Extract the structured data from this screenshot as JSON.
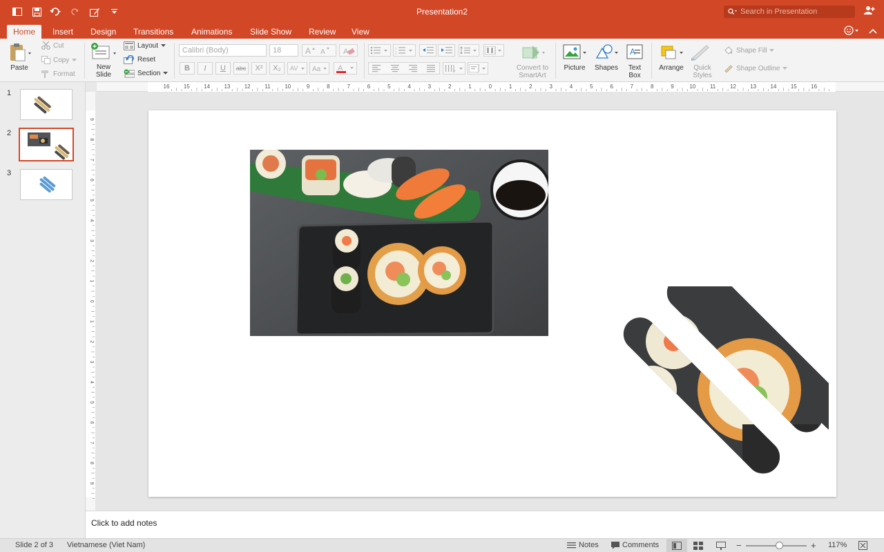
{
  "window": {
    "title": "Presentation2"
  },
  "search": {
    "placeholder": "Search in Presentation"
  },
  "tabs": [
    "Home",
    "Insert",
    "Design",
    "Transitions",
    "Animations",
    "Slide Show",
    "Review",
    "View"
  ],
  "active_tab": "Home",
  "ribbon": {
    "paste": "Paste",
    "cut": "Cut",
    "copy": "Copy",
    "format": "Format",
    "new_slide_line1": "New",
    "new_slide_line2": "Slide",
    "layout": "Layout",
    "reset": "Reset",
    "section": "Section",
    "font_name": "Calibri (Body)",
    "font_size": "18",
    "convert_line1": "Convert to",
    "convert_line2": "SmartArt",
    "picture": "Picture",
    "shapes": "Shapes",
    "textbox_line1": "Text",
    "textbox_line2": "Box",
    "arrange": "Arrange",
    "quick_styles_line1": "Quick",
    "quick_styles_line2": "Styles",
    "shape_fill": "Shape Fill",
    "shape_outline": "Shape Outline"
  },
  "ruler": {
    "h_labels": [
      "16",
      "15",
      "14",
      "13",
      "12",
      "11",
      "10",
      "9",
      "8",
      "7",
      "6",
      "5",
      "4",
      "3",
      "2",
      "1",
      "0",
      "1",
      "2",
      "3",
      "4",
      "5",
      "6",
      "7",
      "8",
      "9",
      "10",
      "11",
      "12",
      "13",
      "14",
      "15",
      "16"
    ],
    "v_labels": [
      "9",
      "8",
      "7",
      "6",
      "5",
      "4",
      "3",
      "2",
      "1",
      "0",
      "1",
      "2",
      "3",
      "4",
      "5",
      "6",
      "7",
      "8",
      "9"
    ]
  },
  "slides": [
    {
      "number": "1"
    },
    {
      "number": "2"
    },
    {
      "number": "3"
    }
  ],
  "notes": {
    "placeholder": "Click to add notes"
  },
  "status": {
    "slide_info": "Slide 2 of 3",
    "language": "Vietnamese (Viet Nam)",
    "notes_btn": "Notes",
    "comments_btn": "Comments",
    "zoom": "117%",
    "zoom_fraction": 0.55
  },
  "colors": {
    "accent": "#d24726"
  }
}
